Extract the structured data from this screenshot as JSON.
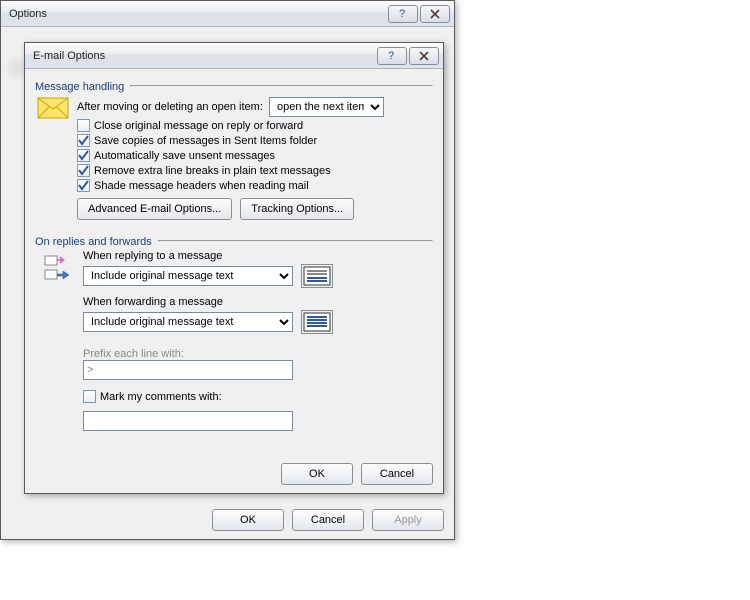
{
  "outer": {
    "title": "Options",
    "buttons": {
      "ok": "OK",
      "cancel": "Cancel",
      "apply": "Apply"
    }
  },
  "inner": {
    "title": "E-mail Options",
    "group1": "Message handling",
    "after_label": "After moving or deleting an open item:",
    "after_value": "open the next item",
    "cb_close": "Close original message on reply or forward",
    "cb_savecopies": "Save copies of messages in Sent Items folder",
    "cb_autosave": "Automatically save unsent messages",
    "cb_removebreaks": "Remove extra line breaks in plain text messages",
    "cb_shade": "Shade message headers when reading mail",
    "btn_adv": "Advanced E-mail Options...",
    "btn_track": "Tracking Options...",
    "group2": "On replies and forwards",
    "reply_label": "When replying to a message",
    "reply_value": "Include original message text",
    "fwd_label": "When forwarding a message",
    "fwd_value": "Include original message text",
    "prefix_label": "Prefix each line with:",
    "prefix_value": ">",
    "cb_mark": "Mark my comments with:",
    "mark_value": "",
    "buttons": {
      "ok": "OK",
      "cancel": "Cancel"
    }
  },
  "checked": {
    "close": false,
    "savecopies": true,
    "autosave": true,
    "removebreaks": true,
    "shade": true,
    "mark": false
  }
}
